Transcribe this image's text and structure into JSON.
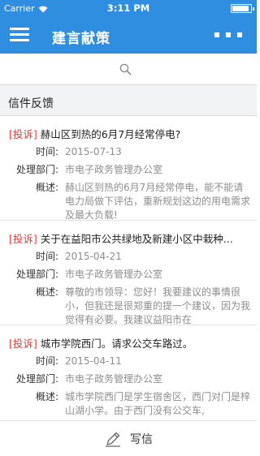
{
  "status_bar": {
    "carrier": "Carrier",
    "time": "3:11 PM"
  },
  "header": {
    "title": "建言献策",
    "menu_icon": "hamburger-menu-icon",
    "more_icon": "more-dots-icon",
    "background_color": "#2f8ee0"
  },
  "search": {
    "icon": "search-icon"
  },
  "section": {
    "title": "信件反馈"
  },
  "labels": {
    "time": "时间:",
    "department": "处理部门:",
    "summary": "概述:"
  },
  "letters": [
    {
      "tag": "[投诉]",
      "title": "赫山区到热的6月7月经常停电?",
      "time": "2015-07-13",
      "department": "市电子政务管理办公室",
      "summary": "赫山区到热的6月7月经常停电，能不能请电力局做下评估，重新规划这边的用电需求及最大负载!"
    },
    {
      "tag": "[投诉]",
      "title": "关于在益阳市公共绿地及新建小区中栽种...",
      "time": "2015-04-21",
      "department": "市电子政务管理办公室",
      "summary": "尊敬的市领导：您好！我要建议的事情很小，但我还是很郑重的提一个建议，因为我觉得有必要。我建议益阳市在"
    },
    {
      "tag": "[投诉]",
      "title": "城市学院西门。请求公交车路过。",
      "time": "2015-04-11",
      "department": "市电子政务管理办公室",
      "summary": "城市学院西门是学生宿舍区，西门对门是梓山湖小学。由于西门没有公交车,"
    }
  ],
  "bottom_bar": {
    "label": "写信",
    "icon": "pen-icon"
  },
  "colors": {
    "tag": "#e23b3b",
    "muted_text": "#8e8e8e",
    "section_bg": "#f2f3f5"
  }
}
